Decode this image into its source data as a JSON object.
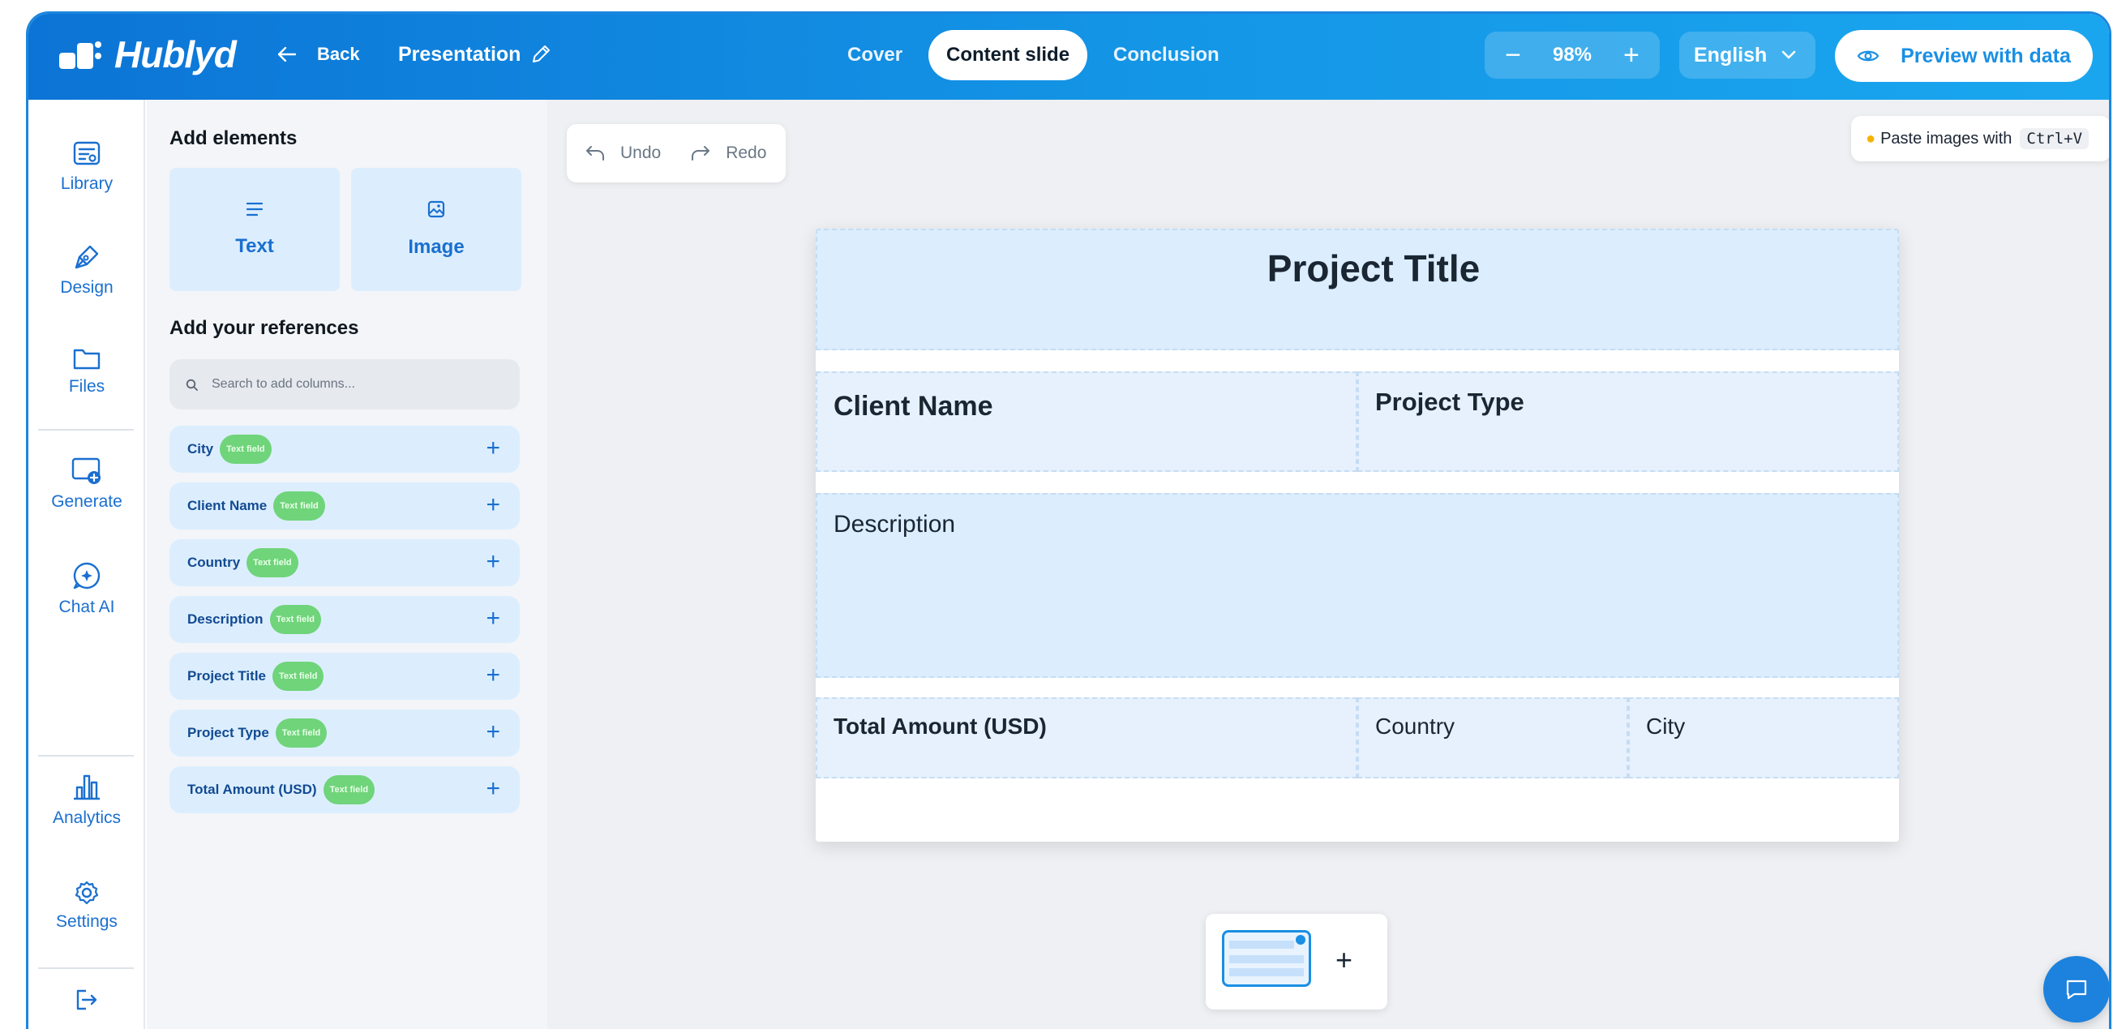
{
  "app": {
    "name": "Hublyd"
  },
  "header": {
    "back_label": "Back",
    "presentation_title": "Presentation",
    "tabs": [
      {
        "label": "Cover",
        "active": false
      },
      {
        "label": "Content slide",
        "active": true
      },
      {
        "label": "Conclusion",
        "active": false
      }
    ],
    "zoom": {
      "minus": "−",
      "value": "98%",
      "plus": "+"
    },
    "language": "English",
    "preview_label": "Preview with data"
  },
  "rail": {
    "items": [
      {
        "label": "Library",
        "icon": "library-icon"
      },
      {
        "label": "Design",
        "icon": "pen-icon"
      },
      {
        "label": "Files",
        "icon": "folder-icon"
      },
      {
        "label": "Generate",
        "icon": "generate-icon"
      },
      {
        "label": "Chat AI",
        "icon": "chat-ai-icon"
      },
      {
        "label": "Analytics",
        "icon": "analytics-icon"
      },
      {
        "label": "Settings",
        "icon": "gear-icon"
      }
    ]
  },
  "panel": {
    "add_elements_title": "Add elements",
    "element_text": "Text",
    "element_image": "Image",
    "references_title": "Add your references",
    "search_placeholder": "Search to add columns...",
    "badge_label": "Text field",
    "references": [
      {
        "name": "City"
      },
      {
        "name": "Client Name"
      },
      {
        "name": "Country"
      },
      {
        "name": "Description"
      },
      {
        "name": "Project Title"
      },
      {
        "name": "Project Type"
      },
      {
        "name": "Total Amount (USD)"
      }
    ],
    "plus": "+"
  },
  "canvas": {
    "undo_label": "Undo",
    "redo_label": "Redo",
    "paste_hint": "Paste images with",
    "paste_shortcut": "Ctrl+V",
    "slide": {
      "title": "Project Title",
      "client_name": "Client Name",
      "project_type": "Project Type",
      "description": "Description",
      "total_amount": "Total Amount (USD)",
      "country": "Country",
      "city": "City"
    },
    "add_slide": "+"
  },
  "colors": {
    "accent": "#1a8fe3",
    "header_start": "#0c74d6",
    "header_end": "#1aa6ef",
    "card_bg": "#dceefe",
    "badge": "#6fd47a",
    "canvas_bg": "#eef0f3"
  }
}
